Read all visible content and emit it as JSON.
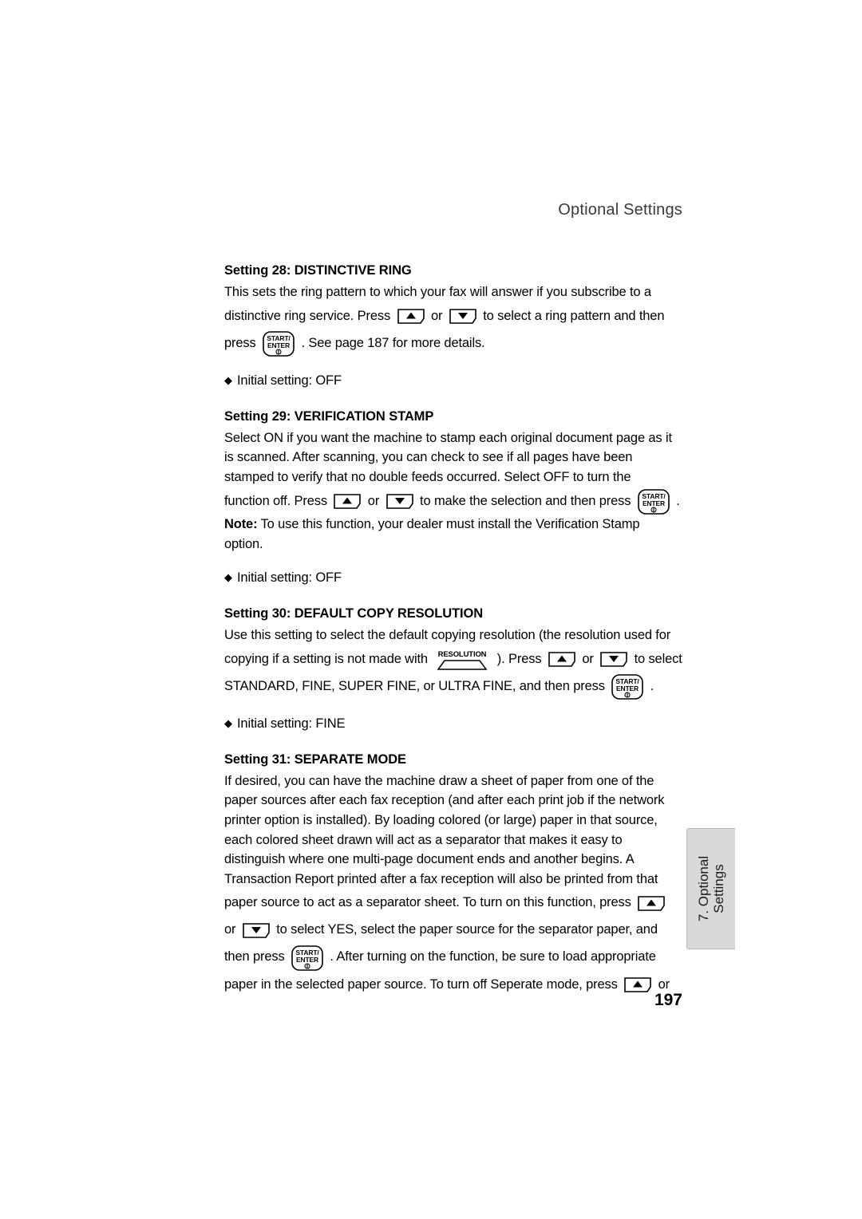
{
  "header": {
    "running_head": "Optional Settings"
  },
  "sections": [
    {
      "title": "Setting 28: DISTINCTIVE RING",
      "para_1": "This sets the ring pattern to which your fax will answer if you subscribe to a",
      "line_2_a": "distinctive ring service. Press",
      "line_2_b": "or",
      "line_2_c": "to select a ring pattern and then",
      "line_3_a": "press",
      "line_3_b": ". See page 187 for more details.",
      "initial": "Initial setting: OFF"
    },
    {
      "title": "Setting 29: VERIFICATION STAMP",
      "para_1": "Select ON if you want the machine to stamp each original document page as it is scanned. After scanning, you can check to see if all pages have been stamped to verify that no double feeds occurred. Select OFF to turn the",
      "line_2_a": "function off. Press",
      "line_2_b": "or",
      "line_2_c": "to make the selection and then press",
      "line_2_d": ".",
      "note_label": "Note:",
      "note_text": " To use this function, your dealer must install the Verification Stamp option.",
      "initial": "Initial setting: OFF"
    },
    {
      "title": "Setting 30: DEFAULT COPY RESOLUTION",
      "para_1": "Use this setting to select the default copying resolution (the resolution used for",
      "line_2_a": "copying if a setting is not made with",
      "line_2_b": "). Press",
      "line_2_c": "or",
      "line_2_d": "to select",
      "line_3_a": "STANDARD, FINE, SUPER FINE, or ULTRA FINE, and then press",
      "line_3_b": ".",
      "initial": "Initial setting: FINE"
    },
    {
      "title": "Setting 31: SEPARATE MODE",
      "para_1": "If desired, you can have the machine draw a sheet of paper from one of the paper sources after each fax reception (and after each print job if the network printer option is installed). By loading colored (or large) paper in that source, each colored sheet drawn will act as a separator that makes it easy to distinguish where one multi-page document ends and another begins. A Transaction Report printed after a fax reception will also be printed from that",
      "line_2_a": "paper source to act as a separator sheet. To turn on this function, press",
      "line_3_a": "or",
      "line_3_b": "to select YES, select the paper source for the separator paper, and",
      "line_4_a": "then press",
      "line_4_b": ". After turning on the function, be sure to load appropriate",
      "line_5_a": "paper in the selected paper source. To turn off Seperate mode, press",
      "line_5_b": "or"
    }
  ],
  "side_tab": {
    "line_1": "7. Optional",
    "line_2": "Settings"
  },
  "footer": {
    "page_number": "197"
  },
  "keys": {
    "up_arrow_icon": "up-arrow-key",
    "down_arrow_icon": "down-arrow-key",
    "start_enter_label_top": "START/",
    "start_enter_label_bottom": "ENTER",
    "resolution_label": "RESOLUTION"
  }
}
